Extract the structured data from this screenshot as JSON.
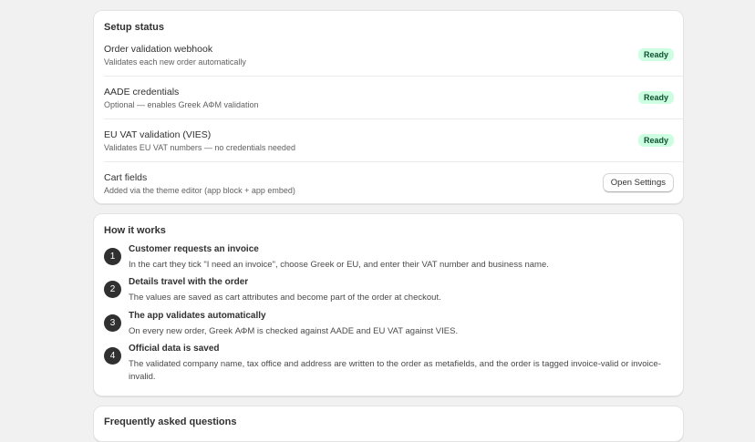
{
  "setup": {
    "title": "Setup status",
    "rows": [
      {
        "title": "Order validation webhook",
        "subtitle": "Validates each new order automatically",
        "badge": "Ready"
      },
      {
        "title": "AADE credentials",
        "subtitle": "Optional — enables Greek ΑΦΜ validation",
        "badge": "Ready"
      },
      {
        "title": "EU VAT validation (VIES)",
        "subtitle": "Validates EU VAT numbers — no credentials needed",
        "badge": "Ready"
      },
      {
        "title": "Cart fields",
        "subtitle": "Added via the theme editor (app block + app embed)",
        "button": "Open Settings"
      }
    ]
  },
  "how": {
    "title": "How it works",
    "steps": [
      {
        "num": "1",
        "title": "Customer requests an invoice",
        "desc": "In the cart they tick \"I need an invoice\", choose Greek or EU, and enter their VAT number and business name."
      },
      {
        "num": "2",
        "title": "Details travel with the order",
        "desc": "The values are saved as cart attributes and become part of the order at checkout."
      },
      {
        "num": "3",
        "title": "The app validates automatically",
        "desc": "On every new order, Greek ΑΦΜ is checked against AADE and EU VAT against VIES."
      },
      {
        "num": "4",
        "title": "Official data is saved",
        "desc": "The validated company name, tax office and address are written to the order as metafields, and the order is tagged invoice-valid or invoice-invalid."
      }
    ]
  },
  "faq": {
    "title": "Frequently asked questions"
  },
  "colors": {
    "background": "#f1f1f1",
    "card": "#ffffff",
    "badge_bg": "#cdfee1",
    "badge_text": "#0c5132",
    "step_circle": "#303030"
  }
}
